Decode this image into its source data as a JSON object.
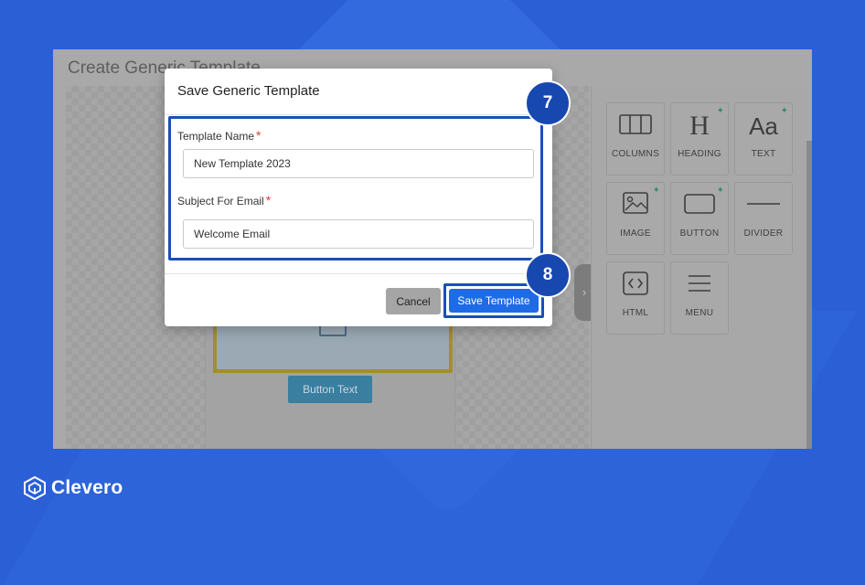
{
  "page": {
    "title": "Create Generic Template"
  },
  "modal": {
    "title": "Save Generic Template",
    "template_name_label": "Template Name",
    "template_name_value": "New Template 2023",
    "subject_label": "Subject For Email",
    "subject_value": "Welcome Email",
    "required_mark": "*",
    "cancel_label": "Cancel",
    "save_label": "Save Template"
  },
  "canvas": {
    "button_text": "Button Text"
  },
  "panel": {
    "tiles": [
      {
        "label": "COLUMNS",
        "icon": "columns-icon"
      },
      {
        "label": "HEADING",
        "icon": "heading-icon",
        "glyph": "H"
      },
      {
        "label": "TEXT",
        "icon": "text-icon",
        "glyph": "Aa"
      },
      {
        "label": "IMAGE",
        "icon": "image-icon"
      },
      {
        "label": "BUTTON",
        "icon": "button-icon"
      },
      {
        "label": "DIVIDER",
        "icon": "divider-icon"
      },
      {
        "label": "HTML",
        "icon": "html-icon"
      },
      {
        "label": "MENU",
        "icon": "menu-icon"
      }
    ]
  },
  "steps": {
    "step7": "7",
    "step8": "8"
  },
  "brand": {
    "name": "Clevero"
  },
  "colors": {
    "accent": "#1f6be6",
    "highlight": "#1b4fb8",
    "background": "#2a5fd6",
    "required": "#e03b3b"
  }
}
